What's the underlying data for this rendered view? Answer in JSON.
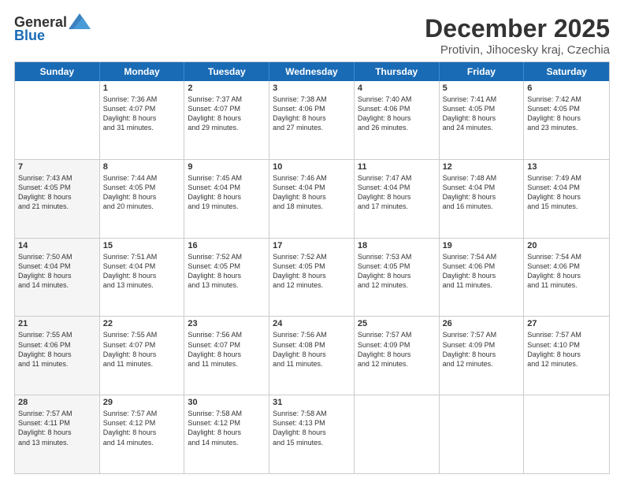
{
  "header": {
    "logo": {
      "general": "General",
      "blue": "Blue"
    },
    "title": "December 2025",
    "subtitle": "Protivin, Jihocesky kraj, Czechia"
  },
  "calendar": {
    "days_of_week": [
      "Sunday",
      "Monday",
      "Tuesday",
      "Wednesday",
      "Thursday",
      "Friday",
      "Saturday"
    ],
    "weeks": [
      [
        {
          "day": "",
          "info": "",
          "shaded": false
        },
        {
          "day": "1",
          "info": "Sunrise: 7:36 AM\nSunset: 4:07 PM\nDaylight: 8 hours\nand 31 minutes.",
          "shaded": false
        },
        {
          "day": "2",
          "info": "Sunrise: 7:37 AM\nSunset: 4:07 PM\nDaylight: 8 hours\nand 29 minutes.",
          "shaded": false
        },
        {
          "day": "3",
          "info": "Sunrise: 7:38 AM\nSunset: 4:06 PM\nDaylight: 8 hours\nand 27 minutes.",
          "shaded": false
        },
        {
          "day": "4",
          "info": "Sunrise: 7:40 AM\nSunset: 4:06 PM\nDaylight: 8 hours\nand 26 minutes.",
          "shaded": false
        },
        {
          "day": "5",
          "info": "Sunrise: 7:41 AM\nSunset: 4:05 PM\nDaylight: 8 hours\nand 24 minutes.",
          "shaded": false
        },
        {
          "day": "6",
          "info": "Sunrise: 7:42 AM\nSunset: 4:05 PM\nDaylight: 8 hours\nand 23 minutes.",
          "shaded": false
        }
      ],
      [
        {
          "day": "7",
          "info": "Sunrise: 7:43 AM\nSunset: 4:05 PM\nDaylight: 8 hours\nand 21 minutes.",
          "shaded": true
        },
        {
          "day": "8",
          "info": "Sunrise: 7:44 AM\nSunset: 4:05 PM\nDaylight: 8 hours\nand 20 minutes.",
          "shaded": false
        },
        {
          "day": "9",
          "info": "Sunrise: 7:45 AM\nSunset: 4:04 PM\nDaylight: 8 hours\nand 19 minutes.",
          "shaded": false
        },
        {
          "day": "10",
          "info": "Sunrise: 7:46 AM\nSunset: 4:04 PM\nDaylight: 8 hours\nand 18 minutes.",
          "shaded": false
        },
        {
          "day": "11",
          "info": "Sunrise: 7:47 AM\nSunset: 4:04 PM\nDaylight: 8 hours\nand 17 minutes.",
          "shaded": false
        },
        {
          "day": "12",
          "info": "Sunrise: 7:48 AM\nSunset: 4:04 PM\nDaylight: 8 hours\nand 16 minutes.",
          "shaded": false
        },
        {
          "day": "13",
          "info": "Sunrise: 7:49 AM\nSunset: 4:04 PM\nDaylight: 8 hours\nand 15 minutes.",
          "shaded": false
        }
      ],
      [
        {
          "day": "14",
          "info": "Sunrise: 7:50 AM\nSunset: 4:04 PM\nDaylight: 8 hours\nand 14 minutes.",
          "shaded": true
        },
        {
          "day": "15",
          "info": "Sunrise: 7:51 AM\nSunset: 4:04 PM\nDaylight: 8 hours\nand 13 minutes.",
          "shaded": false
        },
        {
          "day": "16",
          "info": "Sunrise: 7:52 AM\nSunset: 4:05 PM\nDaylight: 8 hours\nand 13 minutes.",
          "shaded": false
        },
        {
          "day": "17",
          "info": "Sunrise: 7:52 AM\nSunset: 4:05 PM\nDaylight: 8 hours\nand 12 minutes.",
          "shaded": false
        },
        {
          "day": "18",
          "info": "Sunrise: 7:53 AM\nSunset: 4:05 PM\nDaylight: 8 hours\nand 12 minutes.",
          "shaded": false
        },
        {
          "day": "19",
          "info": "Sunrise: 7:54 AM\nSunset: 4:06 PM\nDaylight: 8 hours\nand 11 minutes.",
          "shaded": false
        },
        {
          "day": "20",
          "info": "Sunrise: 7:54 AM\nSunset: 4:06 PM\nDaylight: 8 hours\nand 11 minutes.",
          "shaded": false
        }
      ],
      [
        {
          "day": "21",
          "info": "Sunrise: 7:55 AM\nSunset: 4:06 PM\nDaylight: 8 hours\nand 11 minutes.",
          "shaded": true
        },
        {
          "day": "22",
          "info": "Sunrise: 7:55 AM\nSunset: 4:07 PM\nDaylight: 8 hours\nand 11 minutes.",
          "shaded": false
        },
        {
          "day": "23",
          "info": "Sunrise: 7:56 AM\nSunset: 4:07 PM\nDaylight: 8 hours\nand 11 minutes.",
          "shaded": false
        },
        {
          "day": "24",
          "info": "Sunrise: 7:56 AM\nSunset: 4:08 PM\nDaylight: 8 hours\nand 11 minutes.",
          "shaded": false
        },
        {
          "day": "25",
          "info": "Sunrise: 7:57 AM\nSunset: 4:09 PM\nDaylight: 8 hours\nand 12 minutes.",
          "shaded": false
        },
        {
          "day": "26",
          "info": "Sunrise: 7:57 AM\nSunset: 4:09 PM\nDaylight: 8 hours\nand 12 minutes.",
          "shaded": false
        },
        {
          "day": "27",
          "info": "Sunrise: 7:57 AM\nSunset: 4:10 PM\nDaylight: 8 hours\nand 12 minutes.",
          "shaded": false
        }
      ],
      [
        {
          "day": "28",
          "info": "Sunrise: 7:57 AM\nSunset: 4:11 PM\nDaylight: 8 hours\nand 13 minutes.",
          "shaded": true
        },
        {
          "day": "29",
          "info": "Sunrise: 7:57 AM\nSunset: 4:12 PM\nDaylight: 8 hours\nand 14 minutes.",
          "shaded": false
        },
        {
          "day": "30",
          "info": "Sunrise: 7:58 AM\nSunset: 4:12 PM\nDaylight: 8 hours\nand 14 minutes.",
          "shaded": false
        },
        {
          "day": "31",
          "info": "Sunrise: 7:58 AM\nSunset: 4:13 PM\nDaylight: 8 hours\nand 15 minutes.",
          "shaded": false
        },
        {
          "day": "",
          "info": "",
          "shaded": false
        },
        {
          "day": "",
          "info": "",
          "shaded": false
        },
        {
          "day": "",
          "info": "",
          "shaded": false
        }
      ]
    ]
  }
}
